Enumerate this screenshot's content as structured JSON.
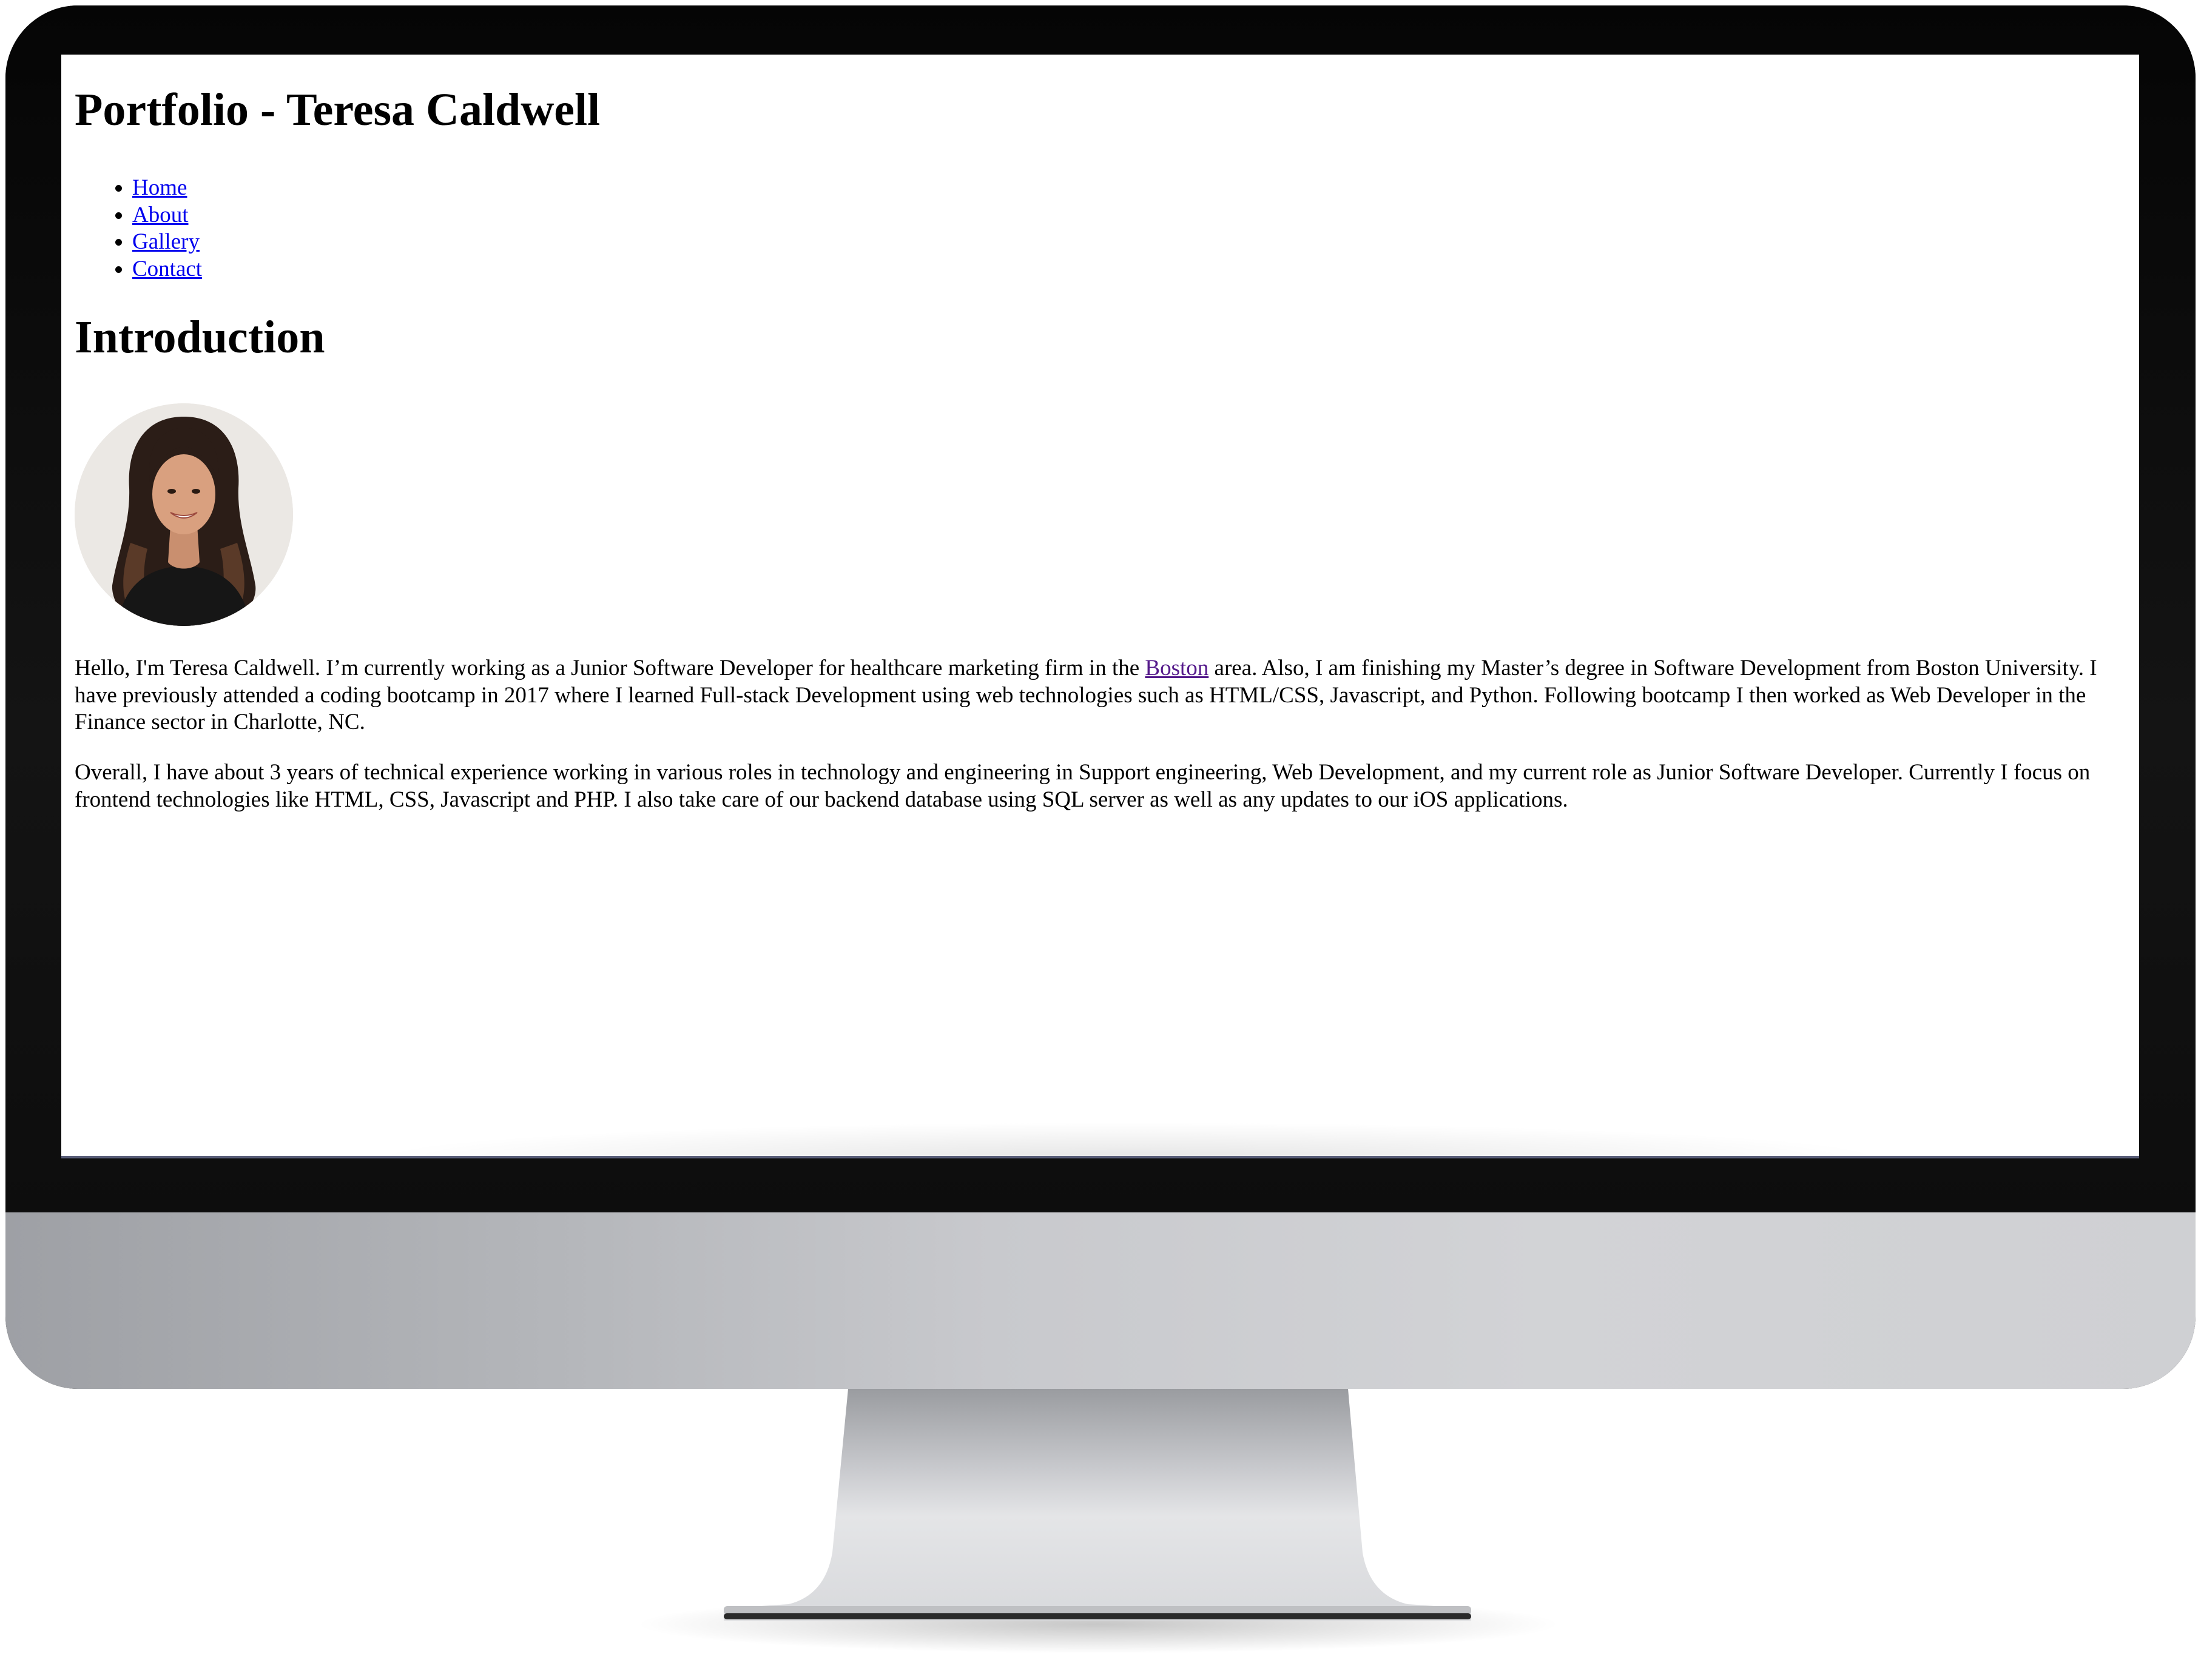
{
  "page": {
    "title": "Portfolio - Teresa Caldwell",
    "nav": [
      {
        "label": "Home"
      },
      {
        "label": "About"
      },
      {
        "label": "Gallery"
      },
      {
        "label": "Contact"
      }
    ],
    "section_title": "Introduction",
    "avatar_icon": "profile-photo",
    "para1": {
      "before_link": "Hello, I'm Teresa Caldwell. I’m currently working as a Junior Software Developer for healthcare marketing firm in the ",
      "link": "Boston",
      "after_link": " area. Also, I am finishing my Master’s degree in Software Development from Boston University. I have previously attended a coding bootcamp in 2017 where I learned Full-stack Development using web technologies such as HTML/CSS, Javascript, and Python. Following bootcamp I then worked as Web Developer in the Finance sector in Charlotte, NC."
    },
    "para2": "Overall, I have about 3 years of technical experience working in various roles in technology and engineering in Support engineering, Web Development, and my current role as Junior Software Developer. Currently I focus on frontend technologies like HTML, CSS, Javascript and PHP. I also take care of our backend database using SQL server as well as any updates to our iOS applications."
  },
  "colors": {
    "link": "#0000ee",
    "visited_link": "#551a8b",
    "bezel": "#0d0d0d",
    "chin": "#c8c9cd"
  }
}
